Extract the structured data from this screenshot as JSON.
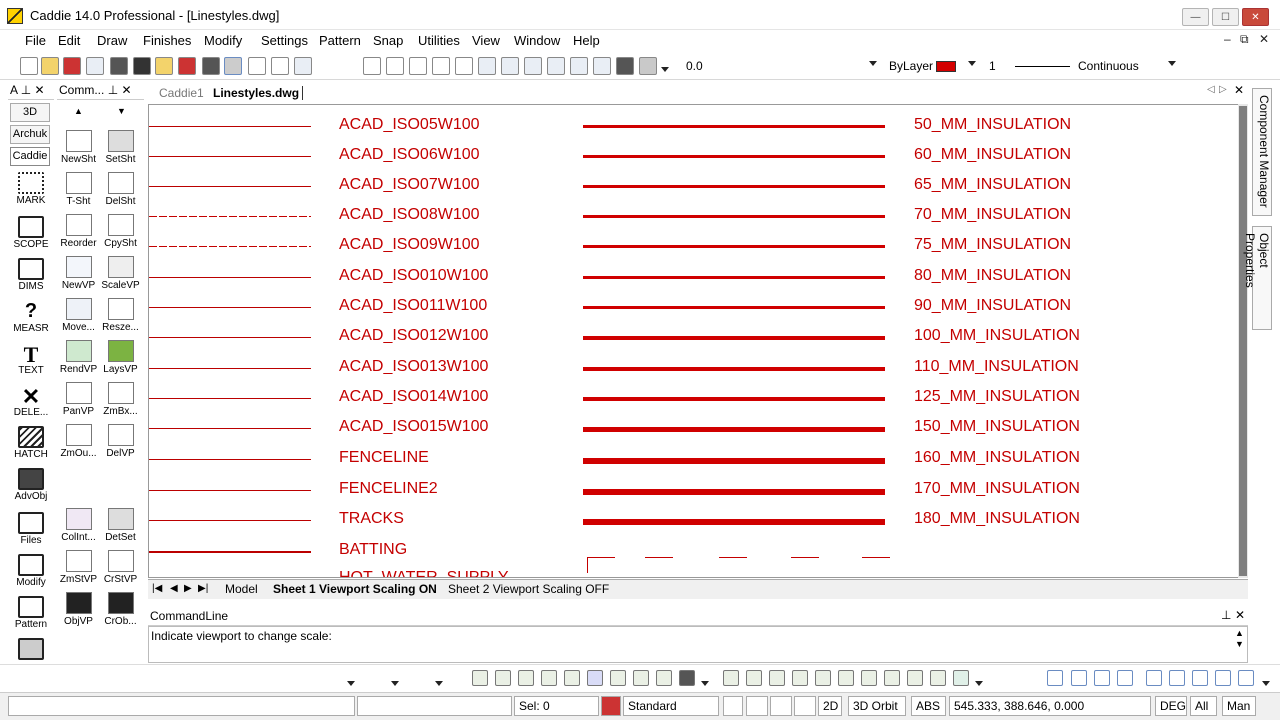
{
  "window": {
    "title": "Caddie 14.0 Professional - [Linestyles.dwg]",
    "minimize": "—",
    "maximize": "☐",
    "close": "✕"
  },
  "menu": [
    "File",
    "Edit",
    "Draw",
    "Finishes",
    "Modify",
    "Settings",
    "Pattern",
    "Snap",
    "Utilities",
    "View",
    "Window",
    "Help"
  ],
  "mdi_controls": [
    "–",
    "⧉",
    "✕"
  ],
  "toolbar": {
    "angle": "0.0",
    "layer_label": "ByLayer",
    "layer_color": "#d40000",
    "line_weight": "1",
    "linetype": "Continuous"
  },
  "left_panel": {
    "header": "A",
    "tabs": [
      "3D",
      "Archuk",
      "Caddie"
    ],
    "tools": [
      "MARK",
      "SCOPE",
      "DIMS",
      "MEASR",
      "TEXT",
      "DELE...",
      "HATCH",
      "AdvObj",
      "Files",
      "Modify",
      "Pattern"
    ]
  },
  "command_panel": {
    "header": "Comm...",
    "tools": [
      [
        "NewSht",
        "SetSht"
      ],
      [
        "T-Sht",
        "DelSht"
      ],
      [
        "Reorder",
        "CpySht"
      ],
      [
        "NewVP",
        "ScaleVP"
      ],
      [
        "Move...",
        "Resze..."
      ],
      [
        "RendVP",
        "LaysVP"
      ],
      [
        "PanVP",
        "ZmBx..."
      ],
      [
        "ZmOu...",
        "DelVP"
      ],
      [
        "ColInt...",
        "DetSet"
      ],
      [
        "ZmStVP",
        "CrStVP"
      ],
      [
        "ObjVP",
        "CrOb..."
      ]
    ]
  },
  "doc_tabs": [
    "Caddie1",
    "Linestyles.dwg"
  ],
  "drawing": {
    "line_color": "#c40000",
    "linetypes": [
      {
        "name": "ACAD_ISO05W100",
        "insulation": "50_MM_INSULATION"
      },
      {
        "name": "ACAD_ISO06W100",
        "insulation": "60_MM_INSULATION"
      },
      {
        "name": "ACAD_ISO07W100",
        "insulation": "65_MM_INSULATION"
      },
      {
        "name": "ACAD_ISO08W100",
        "insulation": "70_MM_INSULATION"
      },
      {
        "name": "ACAD_ISO09W100",
        "insulation": "75_MM_INSULATION"
      },
      {
        "name": "ACAD_ISO010W100",
        "insulation": "80_MM_INSULATION"
      },
      {
        "name": "ACAD_ISO011W100",
        "insulation": "90_MM_INSULATION"
      },
      {
        "name": "ACAD_ISO012W100",
        "insulation": "100_MM_INSULATION"
      },
      {
        "name": "ACAD_ISO013W100",
        "insulation": "110_MM_INSULATION"
      },
      {
        "name": "ACAD_ISO014W100",
        "insulation": "125_MM_INSULATION"
      },
      {
        "name": "ACAD_ISO015W100",
        "insulation": "150_MM_INSULATION"
      },
      {
        "name": "FENCELINE",
        "insulation": "160_MM_INSULATION"
      },
      {
        "name": "FENCELINE2",
        "insulation": "170_MM_INSULATION"
      },
      {
        "name": "TRACKS",
        "insulation": "180_MM_INSULATION"
      },
      {
        "name": "BATTING",
        "insulation": ""
      },
      {
        "name": "HOT_WATER_SUPPLY",
        "insulation": ""
      }
    ]
  },
  "sidebar_tabs": [
    "Component Manager",
    "Object Properties"
  ],
  "sheet_tabs": [
    "Model",
    "Sheet 1 Viewport Scaling ON",
    "Sheet 2 Viewport Scaling OFF"
  ],
  "command_line": {
    "title": "CommandLine",
    "prompt": "Indicate viewport to change scale:"
  },
  "status": {
    "sel": "Sel: 0",
    "style": "Standard",
    "mode_2d": "2D",
    "orbit": "3D Orbit",
    "abs": "ABS",
    "coords": "545.333, 388.646, 0.000",
    "deg": "DEG",
    "all": "All",
    "man": "Man"
  }
}
